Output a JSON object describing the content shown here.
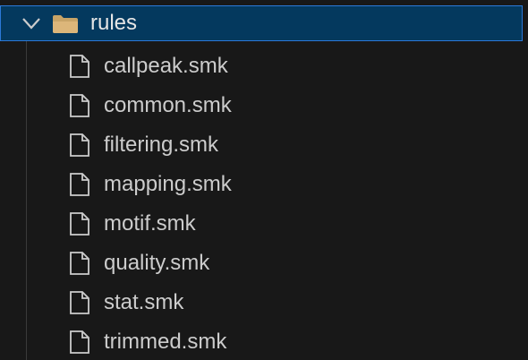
{
  "explorer": {
    "folder": {
      "label": "rules",
      "expanded": true,
      "chevron_icon": "chevron-down-icon",
      "icon": "folder-icon",
      "folder_color": "#c8a467",
      "selected_bg": "#04395e",
      "selected_border": "#2b79d8"
    },
    "files": [
      {
        "label": "callpeak.smk",
        "icon": "file-icon"
      },
      {
        "label": "common.smk",
        "icon": "file-icon"
      },
      {
        "label": "filtering.smk",
        "icon": "file-icon"
      },
      {
        "label": "mapping.smk",
        "icon": "file-icon"
      },
      {
        "label": "motif.smk",
        "icon": "file-icon"
      },
      {
        "label": "quality.smk",
        "icon": "file-icon"
      },
      {
        "label": "stat.smk",
        "icon": "file-icon"
      },
      {
        "label": "trimmed.smk",
        "icon": "file-icon"
      }
    ]
  }
}
